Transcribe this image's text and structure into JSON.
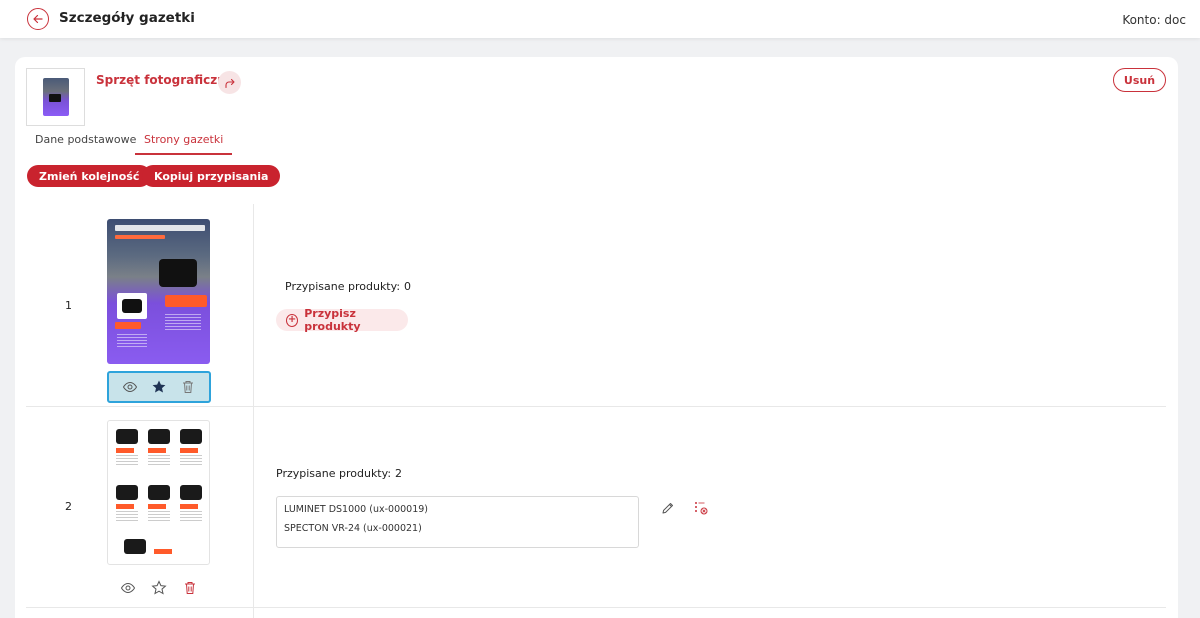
{
  "header": {
    "title": "Szczegóły gazetki",
    "account_label": "Konto: doc"
  },
  "flyer": {
    "name": "Sprzęt fotograficzny",
    "delete_label": "Usuń"
  },
  "tabs": [
    {
      "label": "Dane podstawowe",
      "active": false
    },
    {
      "label": "Strony gazetki",
      "active": true
    }
  ],
  "actions": {
    "reorder_label": "Zmień kolejność",
    "copy_label": "Kopiuj przypisania"
  },
  "pages": [
    {
      "number": "1",
      "assigned_label": "Przypisane produkty:",
      "assigned_count": "0",
      "assign_button": "Przypisz produkty",
      "products": []
    },
    {
      "number": "2",
      "assigned_label": "Przypisane produkty:",
      "assigned_count": "2",
      "products": [
        "LUMINET DS1000 (ux-000019)",
        "SPECTON VR-24 (ux-000021)"
      ]
    }
  ],
  "colors": {
    "accent": "#c9232e",
    "selection_border": "#2ea3db",
    "selection_bg": "#c8e3ea",
    "star_active": "#1f3354"
  }
}
